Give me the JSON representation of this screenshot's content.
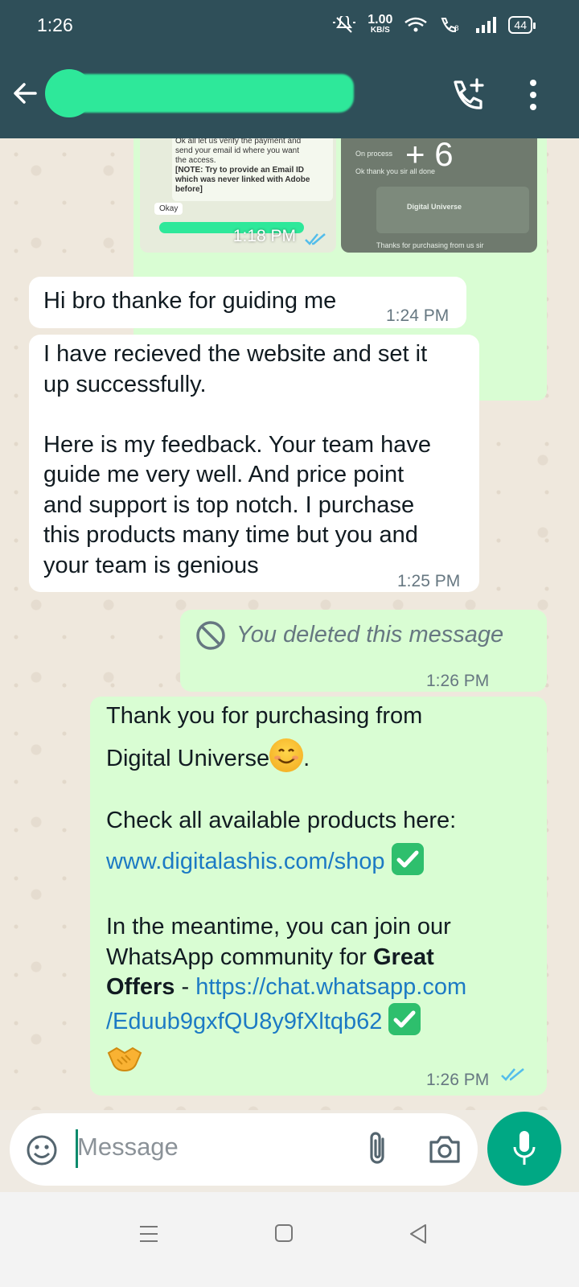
{
  "status_bar": {
    "time": "1:26",
    "net_speed_value": "1.00",
    "net_speed_unit": "KB/S",
    "battery": "44"
  },
  "header": {
    "contact_name": ""
  },
  "media_message": {
    "preview_left_lines": [
      "Ok all let us verify the payment and",
      "send your email id where you want",
      "the access.",
      "[NOTE: Try to provide an Email ID",
      "which was never linked with Adobe",
      "before]"
    ],
    "preview_okay": "Okay",
    "preview_right_process": "On process",
    "preview_right_thanks": "Ok thank you sir all done",
    "preview_right_brand": "Digital Universe",
    "preview_right_footer": "Thanks for purchasing from us sir",
    "more_count": "+ 6",
    "time": "1:18 PM"
  },
  "messages": [
    {
      "direction": "in",
      "text": "Hi bro thanke for guiding me",
      "time": "1:24 PM"
    },
    {
      "direction": "in",
      "text_lines": [
        "I have recieved the website and set it",
        "up successfully.",
        "",
        "Here is my feedback. Your team have",
        "guide me very well. And price point",
        "and support is top notch. I purchase",
        "this products many time but you and",
        "your team is genious"
      ],
      "time": "1:25 PM"
    },
    {
      "direction": "out",
      "text": "You deleted this message",
      "time": "1:26 PM"
    },
    {
      "direction": "out",
      "line1": "Thank you for purchasing from",
      "line2": "Digital Universe",
      "line2_end": ".",
      "line3": "Check all available products here:",
      "link1": "www.digitalashis.com/shop",
      "line4": "In the meantime, you can join our",
      "line5_a": "WhatsApp community for ",
      "line5_bold": "Great",
      "line6_bold": "Offers",
      "line6_dash": " - ",
      "link2_a": "https://chat.whatsapp.com",
      "link2_b": "/Eduub9gxfQU8y9fXltqb62",
      "time": "1:26 PM"
    }
  ],
  "input": {
    "placeholder": "Message"
  },
  "colors": {
    "header": "#2f4f59",
    "outgoing_bubble": "#d9fdd3",
    "incoming_bubble": "#ffffff",
    "accent": "#00a884",
    "link": "#1c7ac4",
    "read_ticks": "#53bdeb"
  },
  "icons": [
    "back-arrow-icon",
    "add-call-icon",
    "more-vert-icon",
    "blocked-icon",
    "read-ticks-icon",
    "emoji-icon",
    "attach-icon",
    "camera-icon",
    "mic-icon",
    "nav-menu-icon",
    "nav-home-icon",
    "nav-back-icon"
  ]
}
